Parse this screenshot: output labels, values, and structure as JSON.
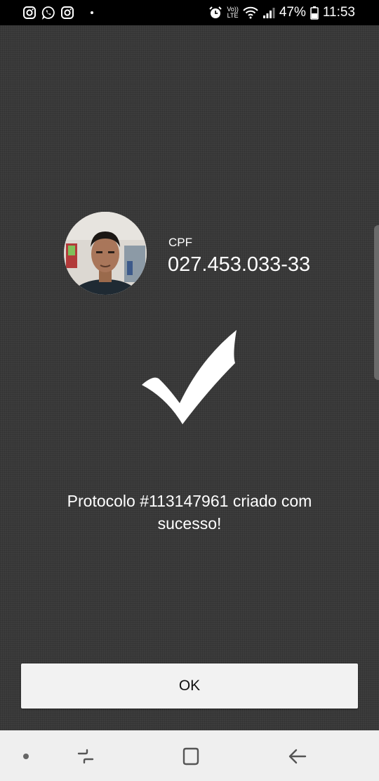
{
  "status_bar": {
    "left_icons": [
      "instagram-icon",
      "whatsapp-icon",
      "instagram-icon"
    ],
    "volte_top": "Vo))",
    "volte_bottom": "LTE",
    "battery_percent": "47%",
    "time": "11:53"
  },
  "profile": {
    "cpf_label": "CPF",
    "cpf_value": "027.453.033-33"
  },
  "message": {
    "text": "Protocolo #113147961 criado com sucesso!"
  },
  "action": {
    "ok_label": "OK"
  },
  "nav_bar": {
    "items": [
      "dot-icon",
      "recent-apps-icon",
      "home-icon",
      "back-icon"
    ]
  },
  "colors": {
    "background": "#3d3d3d",
    "button_bg": "#f2f2f2",
    "status_bar_bg": "#000000",
    "nav_bar_bg": "#efefef"
  }
}
